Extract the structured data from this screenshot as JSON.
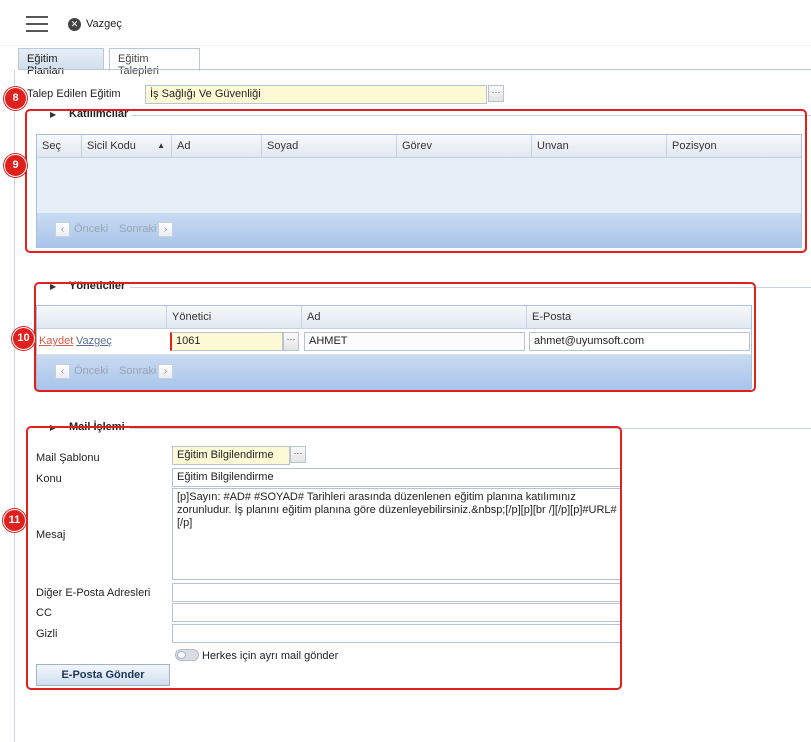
{
  "toolbar": {
    "cancel_label": "Vazgeç"
  },
  "tabs": [
    {
      "label": "Eğitim Planları",
      "active": false
    },
    {
      "label": "Eğitim Talepleri",
      "active": true
    }
  ],
  "requested_training": {
    "label": "Talep Edilen Eğitim",
    "value": "İş Sağlığı Ve Güvenliği"
  },
  "participants": {
    "title": "Katılımcılar",
    "columns": [
      "Seç",
      "Sicil Kodu",
      "Ad",
      "Soyad",
      "Görev",
      "Unvan",
      "Pozisyon"
    ],
    "pager": {
      "prev": "Önceki",
      "next": "Sonraki"
    }
  },
  "managers": {
    "title": "Yöneticiler",
    "columns": [
      "",
      "Yönetici",
      "Ad",
      "E-Posta"
    ],
    "row": {
      "save": "Kaydet",
      "cancel": "Vazgeç",
      "manager": "1061",
      "name": "AHMET",
      "email": "ahmet@uyumsoft.com"
    },
    "pager": {
      "prev": "Önceki",
      "next": "Sonraki"
    }
  },
  "mail": {
    "title": "Mail İşlemi",
    "template_label": "Mail Şablonu",
    "template_value": "Eğitim Bilgilendirme",
    "subject_label": "Konu",
    "subject_value": "Eğitim Bilgilendirme",
    "message_label": "Mesaj",
    "message_value": "[p]Sayın: #AD# #SOYAD# Tarihleri arasında düzenlenen eğitim planına katılımınız zorunludur. İş planını eğitim planına göre düzenleyebilirsiniz.&nbsp;[/p][p][br /][/p][p]#URL#[/p]",
    "other_label": "Diğer E-Posta Adresleri",
    "cc_label": "CC",
    "bcc_label": "Gizli",
    "toggle_label": "Herkes için ayrı mail gönder",
    "send_label": "E-Posta Gönder"
  },
  "badges": [
    "8",
    "9",
    "10",
    "11"
  ],
  "colors": {
    "annotation_red": "#e01f1f",
    "grid_footer": "#b6cdee",
    "required_yellow": "#fffad6"
  }
}
